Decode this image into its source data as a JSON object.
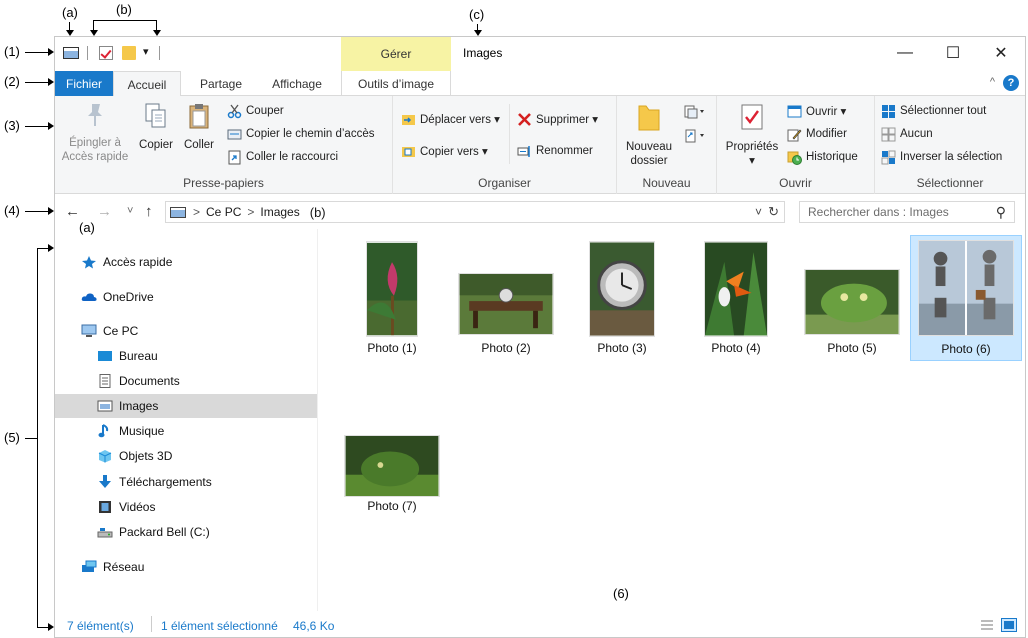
{
  "annotations": {
    "a1": "(a)",
    "b1": "(b)",
    "c1": "(c)",
    "n1": "(1)",
    "n2": "(2)",
    "n3": "(3)",
    "n4": "(4)",
    "n5": "(5)",
    "n6": "(6)",
    "a2": "(a)",
    "b2": "(b)"
  },
  "titlebar": {
    "manage_tab": "Gérer",
    "title": "Images",
    "minimize": "—",
    "maximize": "☐",
    "close": "✕",
    "qat_dropdown": "▾"
  },
  "tabs": {
    "fichier": "Fichier",
    "accueil": "Accueil",
    "partage": "Partage",
    "affichage": "Affichage",
    "outils": "Outils d’image",
    "collapse": "^",
    "help": "?"
  },
  "ribbon": {
    "clipboard": {
      "label": "Presse-papiers",
      "pin_line1": "Épingler à",
      "pin_line2": "Accès rapide",
      "copy": "Copier",
      "paste": "Coller",
      "cut": "Couper",
      "copy_path": "Copier le chemin d’accès",
      "paste_shortcut": "Coller le raccourci"
    },
    "organize": {
      "label": "Organiser",
      "move_to": "Déplacer vers ▾",
      "copy_to": "Copier vers ▾",
      "delete": "Supprimer ▾",
      "rename": "Renommer"
    },
    "new": {
      "label": "Nouveau",
      "new_folder_line1": "Nouveau",
      "new_folder_line2": "dossier"
    },
    "open": {
      "label": "Ouvrir",
      "properties": "Propriétés",
      "properties_drop": "▾",
      "open": "Ouvrir ▾",
      "edit": "Modifier",
      "history": "Historique"
    },
    "select": {
      "label": "Sélectionner",
      "select_all": "Sélectionner tout",
      "none": "Aucun",
      "invert": "Inverser la sélection"
    }
  },
  "address": {
    "back": "←",
    "forward": "→",
    "recent": "˅",
    "up": "↑",
    "sep1": ">",
    "crumb1": "Ce PC",
    "sep2": ">",
    "crumb2": "Images",
    "dropdown": "˅",
    "refresh": "↻",
    "search_placeholder": "Rechercher dans : Images",
    "search_icon": "⚲"
  },
  "nav": {
    "quick_access": "Accès rapide",
    "onedrive": "OneDrive",
    "this_pc": "Ce PC",
    "desktop": "Bureau",
    "documents": "Documents",
    "images": "Images",
    "music": "Musique",
    "objects3d": "Objets 3D",
    "downloads": "Téléchargements",
    "videos": "Vidéos",
    "drive": "Packard Bell (C:)",
    "network": "Réseau"
  },
  "files": [
    {
      "name": "Photo (1)"
    },
    {
      "name": "Photo (2)"
    },
    {
      "name": "Photo (3)"
    },
    {
      "name": "Photo (4)"
    },
    {
      "name": "Photo (5)"
    },
    {
      "name": "Photo (6)"
    },
    {
      "name": "Photo (7)"
    }
  ],
  "status": {
    "count": "7 élément(s)",
    "selected": "1 élément sélectionné",
    "size": "46,6 Ko"
  },
  "colors": {
    "accent": "#1979ca",
    "selection": "#cce8ff",
    "manage_tab": "#f7f3a4"
  }
}
